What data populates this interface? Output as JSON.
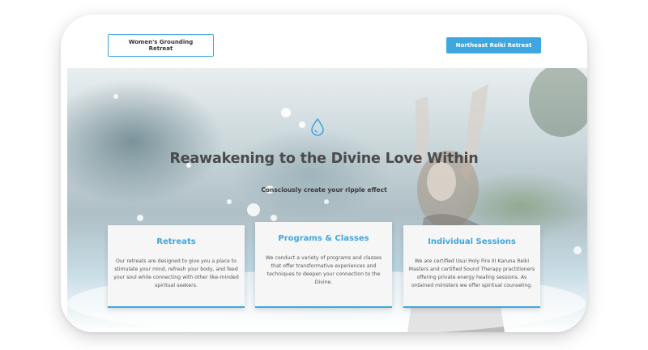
{
  "header": {
    "outline_button": "Women's Grounding Retreat",
    "solid_button": "Northeast Reiki Retreat"
  },
  "hero": {
    "icon": "water-drop-icon",
    "title": "Reawakening to the Divine Love Within",
    "subtitle": "Consciously create your ripple effect"
  },
  "cards": [
    {
      "title": "Retreats",
      "body": "Our retreats are designed to give you a place to stimulate your mind, refresh your body, and feed your soul while connecting with other like-minded spiritual seekers."
    },
    {
      "title": "Programs & Classes",
      "body": "We conduct a variety of programs and classes that offer transformative experiences and techniques to deepen your connection to the Divine."
    },
    {
      "title": "Individual Sessions",
      "body": "We are certified Usui Holy Fire III Karuna Reiki Masters and certified Sound Therapy practitioners offering private energy healing sessions. As ordained ministers we offer spiritual counseling."
    }
  ],
  "colors": {
    "accent": "#3fa7df",
    "title_text": "#4a4a4a",
    "card_bg": "#f6f6f6"
  }
}
